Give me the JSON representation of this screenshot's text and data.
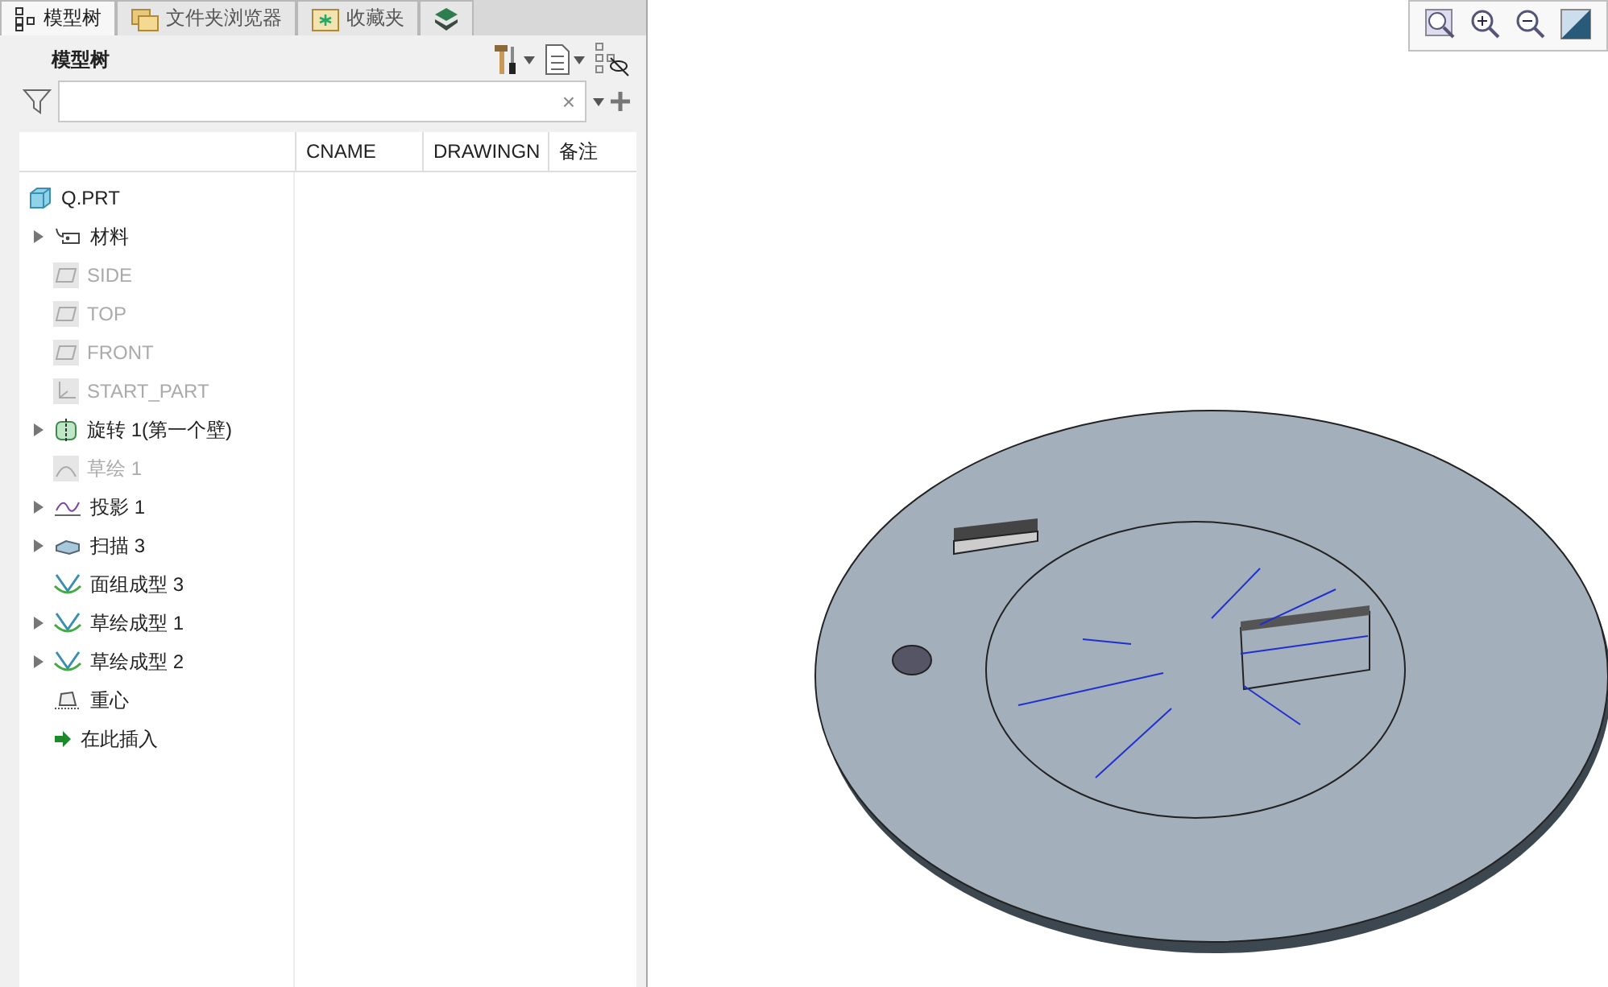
{
  "tabs": [
    {
      "label": "模型树",
      "kind": "tree",
      "selected": true
    },
    {
      "label": "文件夹浏览器",
      "kind": "folder",
      "selected": false
    },
    {
      "label": "收藏夹",
      "kind": "star",
      "selected": false
    },
    {
      "kind": "layers",
      "selected": false
    }
  ],
  "panel": {
    "title": "模型树"
  },
  "search": {
    "clear": "×"
  },
  "columns": [
    "CNAME",
    "DRAWINGN",
    "备注"
  ],
  "tree": [
    {
      "label": "Q.PRT",
      "kind": "part",
      "expandable": false,
      "disabled": false
    },
    {
      "label": "材料",
      "kind": "material",
      "expandable": true,
      "disabled": false
    },
    {
      "label": "SIDE",
      "kind": "plane",
      "expandable": false,
      "disabled": true
    },
    {
      "label": "TOP",
      "kind": "plane",
      "expandable": false,
      "disabled": true
    },
    {
      "label": "FRONT",
      "kind": "plane",
      "expandable": false,
      "disabled": true
    },
    {
      "label": "START_PART",
      "kind": "csys",
      "expandable": false,
      "disabled": true
    },
    {
      "label": "旋转 1(第一个壁)",
      "kind": "revolve",
      "expandable": true,
      "disabled": false
    },
    {
      "label": "草绘 1",
      "kind": "sketch",
      "expandable": false,
      "disabled": true
    },
    {
      "label": "投影 1",
      "kind": "project",
      "expandable": true,
      "disabled": false
    },
    {
      "label": "扫描 3",
      "kind": "sweep",
      "expandable": true,
      "disabled": false
    },
    {
      "label": "面组成型 3",
      "kind": "form",
      "expandable": false,
      "disabled": false
    },
    {
      "label": "草绘成型 1",
      "kind": "form",
      "expandable": true,
      "disabled": false
    },
    {
      "label": "草绘成型 2",
      "kind": "form",
      "expandable": true,
      "disabled": false
    },
    {
      "label": "重心",
      "kind": "centroid",
      "expandable": false,
      "disabled": false
    },
    {
      "label": "在此插入",
      "kind": "insert",
      "expandable": false,
      "disabled": false
    }
  ]
}
